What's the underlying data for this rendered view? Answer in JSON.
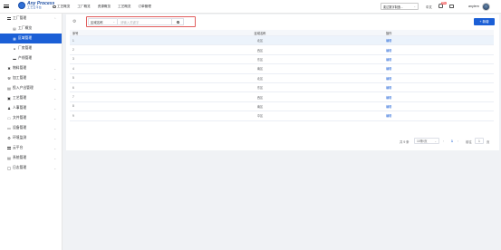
{
  "header": {
    "brand_name": "Any Process",
    "brand_sub": "工艺云平台",
    "nav": [
      {
        "label": "工艺概览"
      },
      {
        "label": "工厂概览"
      },
      {
        "label": "资源概览"
      },
      {
        "label": "工艺概览"
      },
      {
        "label": "订单管理"
      }
    ],
    "factory_select": "麦达数字制造...",
    "language": "中文",
    "bell_badge": "99+",
    "username": "anylern"
  },
  "sidebar": {
    "factory_group": "工厂管理",
    "factory_items": [
      {
        "label": "工厂概览"
      },
      {
        "label": "区域管理"
      },
      {
        "label": "厂房管理"
      },
      {
        "label": "产线管理"
      }
    ],
    "groups": [
      {
        "label": "物料管理"
      },
      {
        "label": "加工管理"
      },
      {
        "label": "投入产出管理"
      },
      {
        "label": "工艺管理"
      },
      {
        "label": "人事管理"
      },
      {
        "label": "文件管理"
      },
      {
        "label": "设备管理"
      },
      {
        "label": "环境监测"
      },
      {
        "label": "云平台"
      },
      {
        "label": "系统管理"
      },
      {
        "label": "日志管理"
      }
    ]
  },
  "toolbar": {
    "field_select": "区域名称",
    "search_placeholder": "请输入关键字",
    "add_label": "+ 新增"
  },
  "table": {
    "headers": [
      "序号",
      "区域名称",
      "操作"
    ],
    "edit_label": "编辑",
    "rows": [
      {
        "index": "1",
        "name": "北区"
      },
      {
        "index": "2",
        "name": "西区"
      },
      {
        "index": "3",
        "name": "东区"
      },
      {
        "index": "4",
        "name": "南区"
      },
      {
        "index": "5",
        "name": "北区"
      },
      {
        "index": "6",
        "name": "东区"
      },
      {
        "index": "7",
        "name": "西区"
      },
      {
        "index": "8",
        "name": "南区"
      },
      {
        "index": "9",
        "name": "中区"
      }
    ]
  },
  "pager": {
    "total": "共 9 条",
    "page_size": "10条/页",
    "prev": "‹",
    "current": "1",
    "next": "›",
    "goto_label": "前往",
    "goto_value": "1",
    "page_suffix": "页"
  },
  "colors": {
    "accent": "#1b5fd6",
    "highlight_border": "#e05c5c",
    "selected_row": "#ecf3fb"
  }
}
